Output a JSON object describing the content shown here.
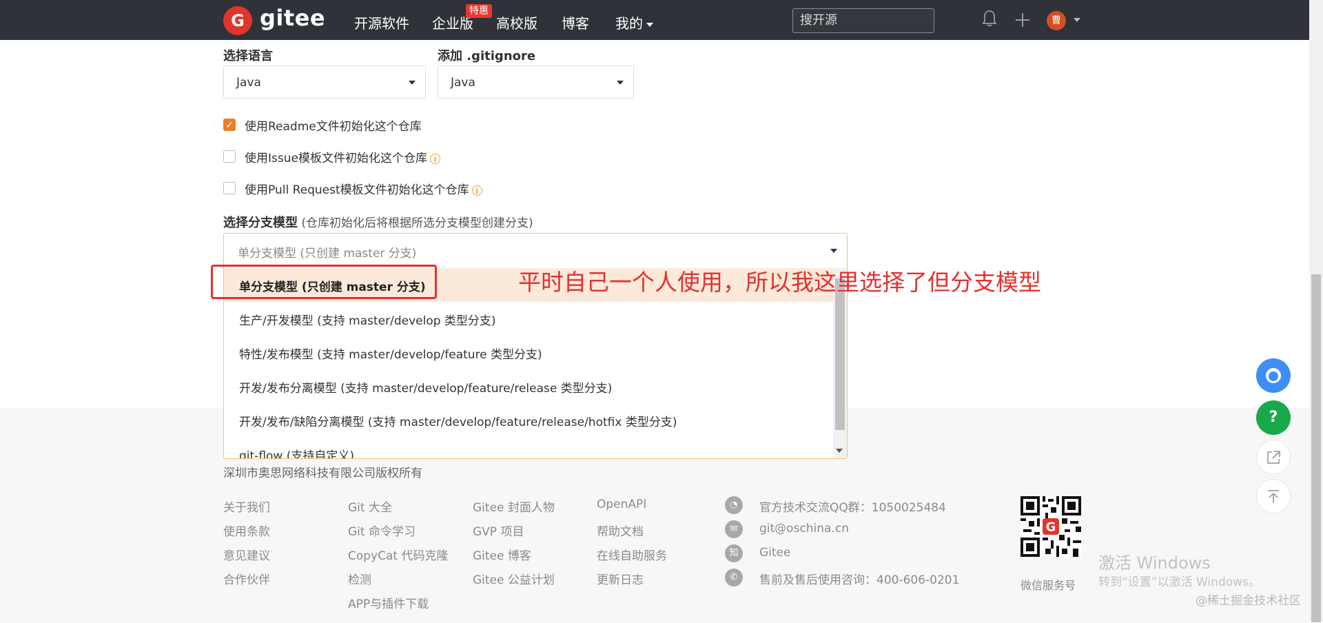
{
  "nav": {
    "logo_letter": "G",
    "brand": "gitee",
    "items": [
      "开源软件",
      "企业版",
      "高校版",
      "博客",
      "我的"
    ],
    "badge": "特惠",
    "search_placeholder": "搜开源",
    "avatar_text": "曹"
  },
  "form": {
    "language_label": "选择语言",
    "language_value": "Java",
    "gitignore_label": "添加 .gitignore",
    "gitignore_value": "Java",
    "checkboxes": [
      {
        "label": "使用Readme文件初始化这个仓库",
        "checked": true
      },
      {
        "label": "使用Issue模板文件初始化这个仓库",
        "checked": false
      },
      {
        "label": "使用Pull Request模板文件初始化这个仓库",
        "checked": false
      }
    ],
    "branch_title": "选择分支模型",
    "branch_hint": "(仓库初始化后将根据所选分支模型创建分支)",
    "branch_selected": "单分支模型 (只创建 master 分支)",
    "branch_options": [
      "单分支模型 (只创建 master 分支)",
      "生产/开发模型 (支持 master/develop 类型分支)",
      "特性/发布模型 (支持 master/develop/feature 类型分支)",
      "开发/发布分离模型 (支持 master/develop/feature/release 类型分支)",
      "开发/发布/缺陷分离模型 (支持 master/develop/feature/release/hotfix 类型分支)",
      "git-flow (支持自定义)"
    ]
  },
  "annotation": "平时自己一个人使用，所以我这里选择了但分支模型",
  "footer": {
    "copyright": "深圳市奥思网络科技有限公司版权所有",
    "col1": [
      "关于我们",
      "使用条款",
      "意见建议",
      "合作伙伴"
    ],
    "col2": [
      "Git 大全",
      "Git 命令学习",
      "CopyCat 代码克隆",
      "检测",
      "APP与插件下载"
    ],
    "col3": [
      "Gitee 封面人物",
      "GVP 项目",
      "Gitee 博客",
      "Gitee 公益计划"
    ],
    "col4": [
      "OpenAPI",
      "帮助文档",
      "在线自助服务",
      "更新日志"
    ],
    "contact": [
      {
        "icon": "qq-icon",
        "text": "官方技术交流QQ群：1050025484"
      },
      {
        "icon": "mail-icon",
        "text": "git@oschina.cn"
      },
      {
        "icon": "zhihu-icon",
        "text": "Gitee",
        "glyph": "知"
      },
      {
        "icon": "phone-icon",
        "text": "售前及售后使用咨询：400-606-0201"
      }
    ],
    "qr_label": "微信服务号"
  },
  "float_buttons": {
    "help": "?"
  },
  "windows": {
    "line1": "激活 Windows",
    "line2": "转到“设置”以激活 Windows。"
  },
  "watermark": "@稀土掘金技术社区",
  "colors": {
    "accent": "#f07c25",
    "nav_bg": "#2f3238",
    "annotation": "#e43030",
    "logo": "#e0352b"
  }
}
